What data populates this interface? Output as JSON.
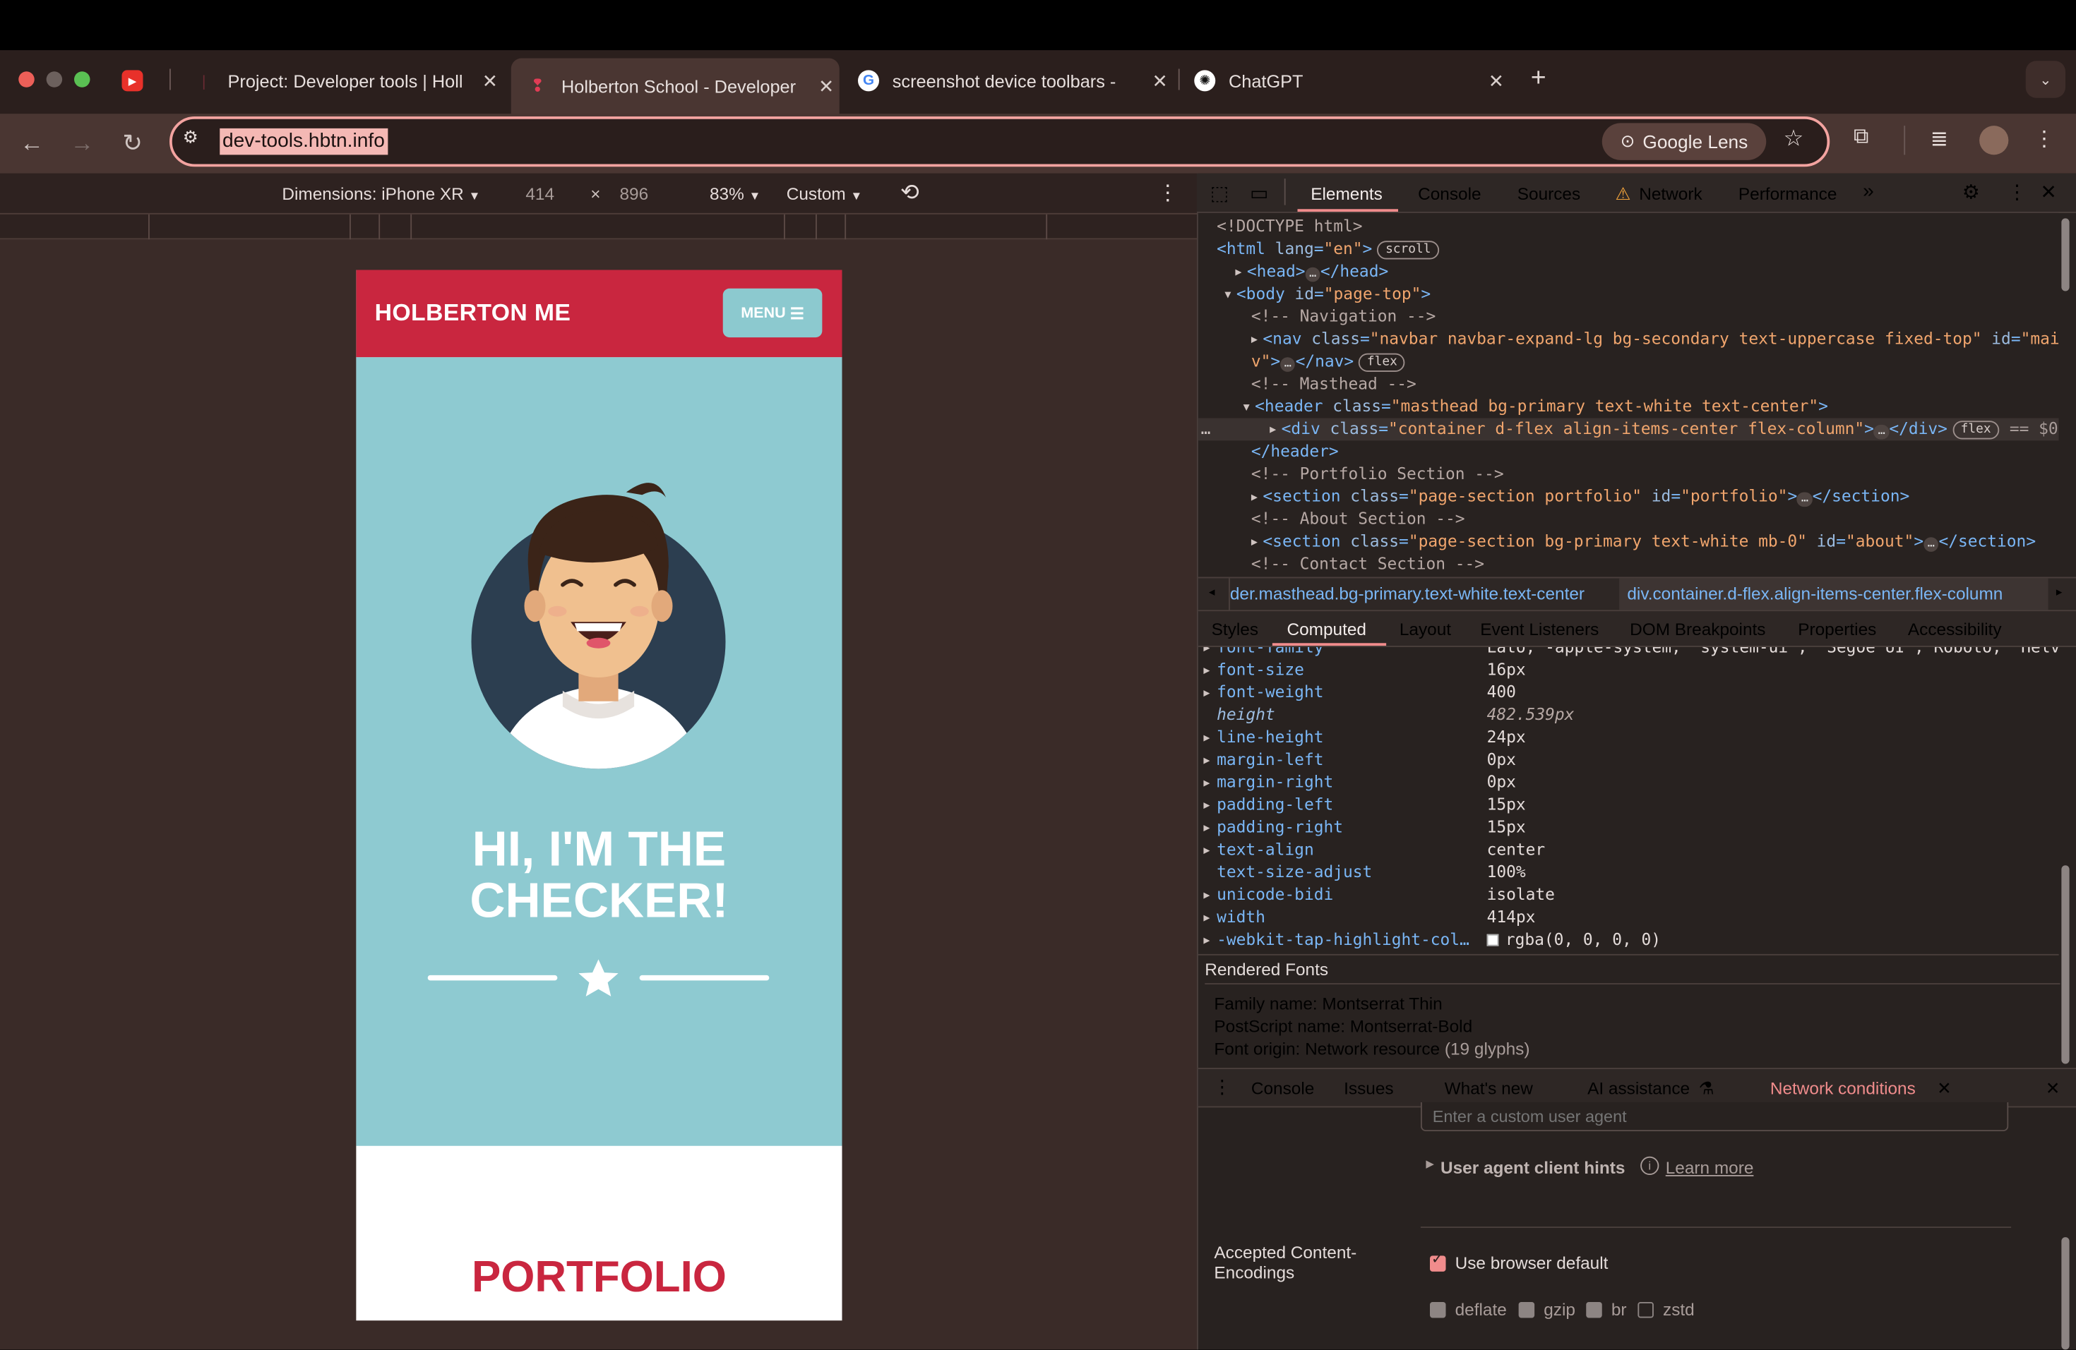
{
  "browser": {
    "tabs": [
      {
        "title": "",
        "favicon": "youtube-icon"
      },
      {
        "title": "Project: Developer tools | Holl",
        "favicon": "holberton-icon"
      },
      {
        "title": "Holberton School - Developer",
        "favicon": "holberton-icon",
        "active": true
      },
      {
        "title": "screenshot device toolbars -",
        "favicon": "google-icon"
      },
      {
        "title": "ChatGPT",
        "favicon": "chatgpt-icon"
      }
    ],
    "url": "dev-tools.hbtn.info",
    "lens_label": "Google Lens",
    "colors": {
      "accent_red": "#c9263f",
      "hero_teal": "#8ecad1",
      "url_highlight": "#f4b8b4"
    }
  },
  "device_toolbar": {
    "dimensions_label": "Dimensions: iPhone XR",
    "width": "414",
    "times": "×",
    "height": "896",
    "zoom": "83%",
    "throttle": "Custom"
  },
  "site": {
    "brand": "HOLBERTON ME",
    "menu_label": "MENU",
    "heading_line1": "HI, I'M THE",
    "heading_line2": "CHECKER!",
    "section_title": "PORTFOLIO"
  },
  "devtools": {
    "tabs": [
      "Elements",
      "Console",
      "Sources",
      "Network",
      "Performance"
    ],
    "more": "»",
    "elements": [
      {
        "text": "<!DOCTYPE html>"
      },
      {
        "parts": [
          [
            "tag",
            "<html "
          ],
          [
            "attr",
            "lang"
          ],
          [
            "tag",
            "="
          ],
          [
            "val",
            "\"en\""
          ],
          [
            "tag",
            ">"
          ]
        ],
        "pill": "scroll"
      },
      {
        "parts": [
          [
            "tag",
            "<head>"
          ],
          [
            "ell",
            "…"
          ],
          [
            "tag",
            "</head>"
          ]
        ]
      },
      {
        "parts": [
          [
            "tag",
            "<body "
          ],
          [
            "attr",
            "id"
          ],
          [
            "tag",
            "="
          ],
          [
            "val",
            "\"page-top\""
          ],
          [
            "tag",
            ">"
          ]
        ]
      },
      {
        "comment": "<!-- Navigation -->"
      },
      {
        "parts": [
          [
            "tag",
            "<nav "
          ],
          [
            "attr",
            "class"
          ],
          [
            "tag",
            "="
          ],
          [
            "val",
            "\"navbar navbar-expand-lg bg-secondary text-uppercase fixed-top\""
          ],
          [
            "tag",
            " "
          ],
          [
            "attr",
            "id"
          ],
          [
            "tag",
            "="
          ],
          [
            "val",
            "\"mainNa"
          ]
        ]
      },
      {
        "parts": [
          [
            "val",
            "v\""
          ],
          [
            "tag",
            ">"
          ],
          [
            "ell",
            "…"
          ],
          [
            "tag",
            "</nav>"
          ]
        ],
        "pill": "flex"
      },
      {
        "comment": "<!-- Masthead -->"
      },
      {
        "parts": [
          [
            "tag",
            "<header "
          ],
          [
            "attr",
            "class"
          ],
          [
            "tag",
            "="
          ],
          [
            "val",
            "\"masthead bg-primary text-white text-center\""
          ],
          [
            "tag",
            ">"
          ]
        ]
      },
      {
        "parts": [
          [
            "tag",
            "<div "
          ],
          [
            "attr",
            "class"
          ],
          [
            "tag",
            "="
          ],
          [
            "val",
            "\"container d-flex align-items-center flex-column\""
          ],
          [
            "tag",
            ">"
          ],
          [
            "ell",
            "…"
          ],
          [
            "tag",
            "</div>"
          ]
        ],
        "pill": "flex",
        "suffix": "== $0"
      },
      {
        "parts": [
          [
            "tag",
            "</header>"
          ]
        ]
      },
      {
        "comment": "<!-- Portfolio Section -->"
      },
      {
        "parts": [
          [
            "tag",
            "<section "
          ],
          [
            "attr",
            "class"
          ],
          [
            "tag",
            "="
          ],
          [
            "val",
            "\"page-section portfolio\""
          ],
          [
            "tag",
            " "
          ],
          [
            "attr",
            "id"
          ],
          [
            "tag",
            "="
          ],
          [
            "val",
            "\"portfolio\""
          ],
          [
            "tag",
            ">"
          ],
          [
            "ell",
            "…"
          ],
          [
            "tag",
            "</section>"
          ]
        ]
      },
      {
        "comment": "<!-- About Section -->"
      },
      {
        "parts": [
          [
            "tag",
            "<section "
          ],
          [
            "attr",
            "class"
          ],
          [
            "tag",
            "="
          ],
          [
            "val",
            "\"page-section bg-primary text-white mb-0\""
          ],
          [
            "tag",
            " "
          ],
          [
            "attr",
            "id"
          ],
          [
            "tag",
            "="
          ],
          [
            "val",
            "\"about\""
          ],
          [
            "tag",
            ">"
          ],
          [
            "ell",
            "…"
          ],
          [
            "tag",
            "</section>"
          ]
        ]
      },
      {
        "comment": "<!-- Contact Section -->"
      }
    ],
    "breadcrumbs": [
      "der.masthead.bg-primary.text-white.text-center",
      "div.container.d-flex.align-items-center.flex-column"
    ],
    "subtabs": [
      "Styles",
      "Computed",
      "Layout",
      "Event Listeners",
      "DOM Breakpoints",
      "Properties",
      "Accessibility"
    ],
    "computed": [
      {
        "prop": "font-family",
        "value": "Lato, -apple-system, \"system-ui\", \"Segoe UI\", Roboto, \"Helvet"
      },
      {
        "prop": "font-size",
        "value": "16px"
      },
      {
        "prop": "font-weight",
        "value": "400"
      },
      {
        "prop": "height",
        "value": "482.539px",
        "italic": true
      },
      {
        "prop": "line-height",
        "value": "24px"
      },
      {
        "prop": "margin-left",
        "value": "0px"
      },
      {
        "prop": "margin-right",
        "value": "0px"
      },
      {
        "prop": "padding-left",
        "value": "15px"
      },
      {
        "prop": "padding-right",
        "value": "15px"
      },
      {
        "prop": "text-align",
        "value": "center"
      },
      {
        "prop": "text-size-adjust",
        "value": "100%",
        "notri": true
      },
      {
        "prop": "unicode-bidi",
        "value": "isolate"
      },
      {
        "prop": "width",
        "value": "414px"
      },
      {
        "prop": "-webkit-tap-highlight-col…",
        "value": "rgba(0, 0, 0, 0)",
        "swatch": true
      }
    ],
    "rendered_fonts": {
      "title": "Rendered Fonts",
      "family": "Family name: Montserrat Thin",
      "postscript": "PostScript name: Montserrat-Bold",
      "origin": "Font origin: Network resource",
      "glyphs": "(19 glyphs)"
    },
    "drawer_tabs": [
      "Console",
      "Issues",
      "What's new",
      "AI assistance",
      "Network conditions"
    ],
    "network_conditions": {
      "ua_placeholder": "Enter a custom user agent",
      "client_hints": "User agent client hints",
      "learn_more": "Learn more",
      "encodings_label_1": "Accepted Content-",
      "encodings_label_2": "Encodings",
      "use_default": "Use browser default",
      "encodings": [
        "deflate",
        "gzip",
        "br",
        "zstd"
      ]
    }
  }
}
